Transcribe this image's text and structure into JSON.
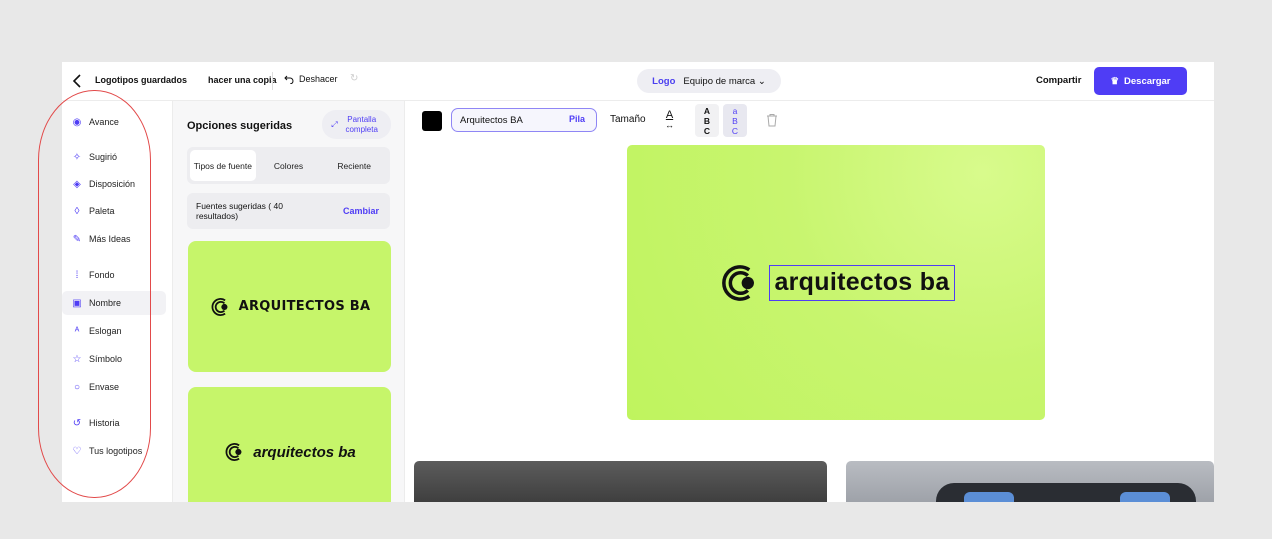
{
  "topbar": {
    "saved_logos": "Logotipos guardados",
    "make_copy": "hacer una copia",
    "undo": "Deshacer",
    "redo_icon": "redo-icon",
    "logo_tab": "Logo",
    "brand_kit": "Equipo de marca",
    "share": "Compartir",
    "download": "Descargar"
  },
  "nav": {
    "items": [
      {
        "label": "Avance",
        "icon": "eye-icon"
      },
      {
        "label": "Sugirió",
        "icon": "sparkle-icon"
      },
      {
        "label": "Disposición",
        "icon": "layers-icon"
      },
      {
        "label": "Paleta",
        "icon": "drop-icon"
      },
      {
        "label": "Más Ideas",
        "icon": "wand-icon"
      },
      {
        "label": "Fondo",
        "icon": "grid-icon"
      },
      {
        "label": "Nombre",
        "icon": "text-box-icon"
      },
      {
        "label": "Eslogan",
        "icon": "font-icon"
      },
      {
        "label": "Símbolo",
        "icon": "star-icon"
      },
      {
        "label": "Envase",
        "icon": "circle-icon"
      },
      {
        "label": "Historia",
        "icon": "history-icon"
      },
      {
        "label": "Tus logotipos",
        "icon": "heart-icon"
      }
    ],
    "active": "Nombre"
  },
  "options": {
    "title": "Opciones sugeridas",
    "fullscreen": "Pantalla completa",
    "tabs": [
      {
        "label": "Tipos de fuente",
        "active": true
      },
      {
        "label": "Colores",
        "active": false
      },
      {
        "label": "Reciente",
        "active": false
      }
    ],
    "suggested_fonts": "Fuentes sugeridas ( 40 resultados)",
    "change": "Cambiar",
    "cards": [
      {
        "name": "ARQUITECTOS BA"
      },
      {
        "name": "arquitectos ba"
      }
    ]
  },
  "editor": {
    "name_value": "Arquitectos BA",
    "stack_label": "Pila",
    "size_label": "Tamaño",
    "size_glyph": "A",
    "upper_case": [
      "A",
      "B",
      "C"
    ],
    "lower_case": [
      "a",
      "B",
      "C"
    ],
    "preview_text": "arquitectos ba"
  },
  "colors": {
    "accent": "#4f3df5",
    "logo_bg": "#c6f56a",
    "annotation": "#e24a4a"
  }
}
